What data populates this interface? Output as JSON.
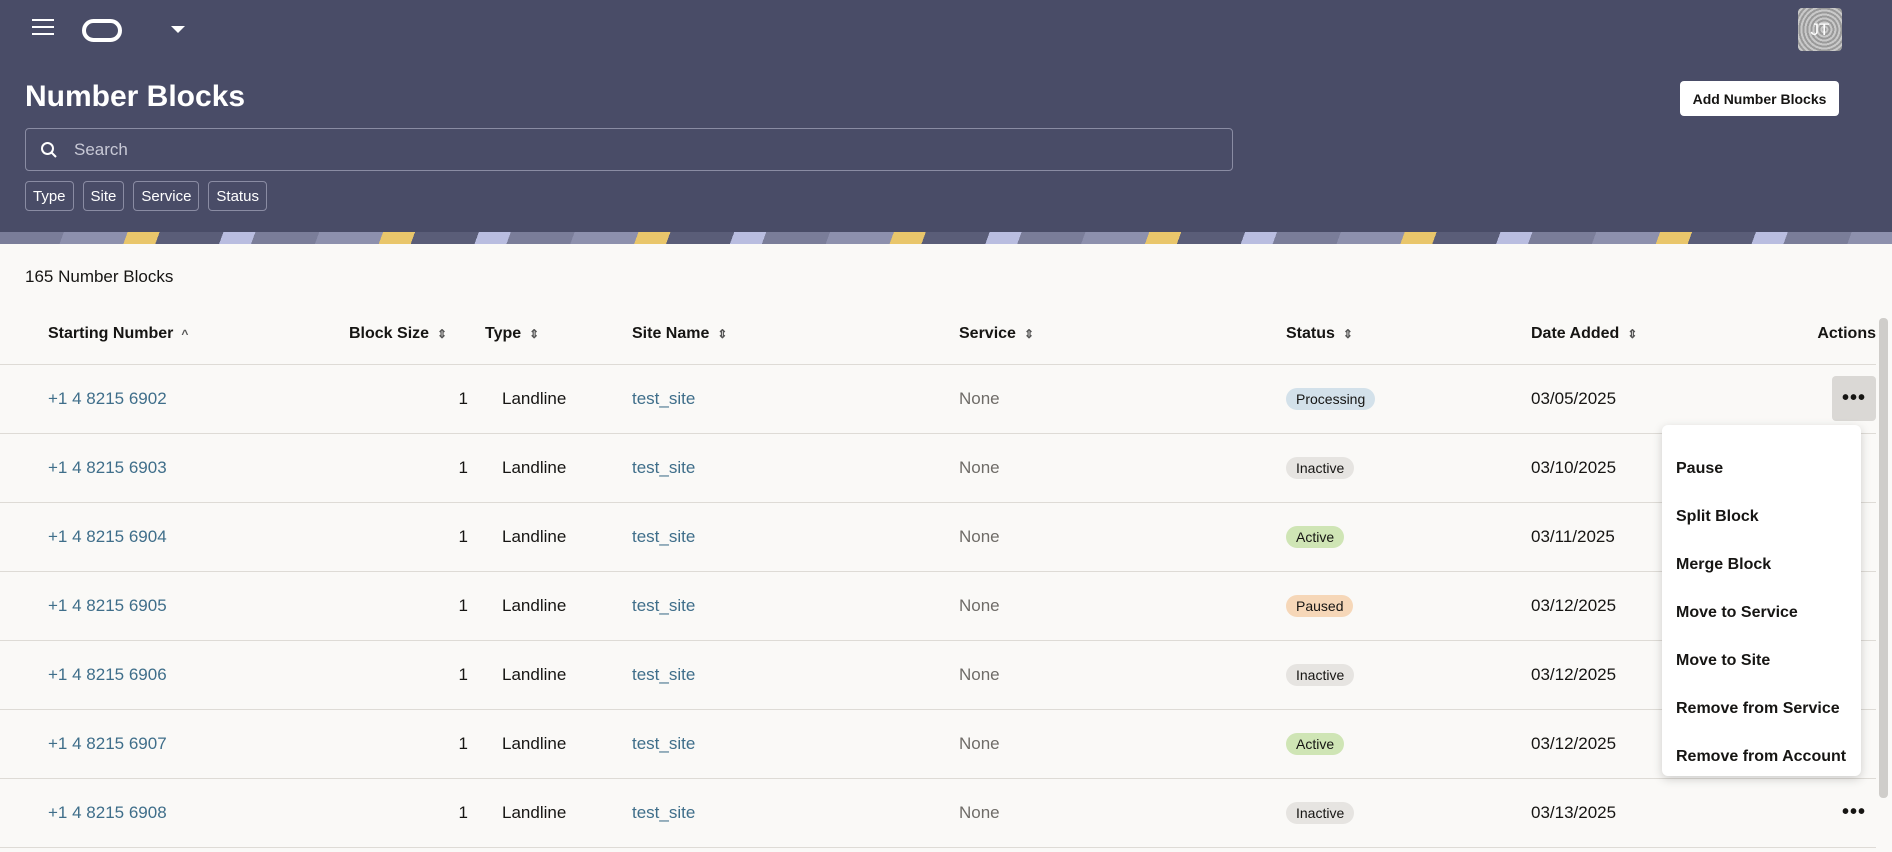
{
  "header": {
    "page_title": "Number Blocks",
    "add_button": "Add Number Blocks",
    "avatar_initials": "JT",
    "search_placeholder": "Search",
    "filters": [
      "Type",
      "Site",
      "Service",
      "Status"
    ]
  },
  "count_label": "165 Number Blocks",
  "table": {
    "columns": [
      "Starting Number",
      "Block Size",
      "Type",
      "Site Name",
      "Service",
      "Status",
      "Date Added",
      "Actions"
    ],
    "rows": [
      {
        "number": "+1 4 8215 6902",
        "size": "1",
        "type": "Landline",
        "site": "test_site",
        "service": "None",
        "status": "Processing",
        "date": "03/05/2025"
      },
      {
        "number": "+1 4 8215 6903",
        "size": "1",
        "type": "Landline",
        "site": "test_site",
        "service": "None",
        "status": "Inactive",
        "date": "03/10/2025"
      },
      {
        "number": "+1 4 8215 6904",
        "size": "1",
        "type": "Landline",
        "site": "test_site",
        "service": "None",
        "status": "Active",
        "date": "03/11/2025"
      },
      {
        "number": "+1 4 8215 6905",
        "size": "1",
        "type": "Landline",
        "site": "test_site",
        "service": "None",
        "status": "Paused",
        "date": "03/12/2025"
      },
      {
        "number": "+1 4 8215 6906",
        "size": "1",
        "type": "Landline",
        "site": "test_site",
        "service": "None",
        "status": "Inactive",
        "date": "03/12/2025"
      },
      {
        "number": "+1 4 8215 6907",
        "size": "1",
        "type": "Landline",
        "site": "test_site",
        "service": "None",
        "status": "Active",
        "date": "03/12/2025"
      },
      {
        "number": "+1 4 8215 6908",
        "size": "1",
        "type": "Landline",
        "site": "test_site",
        "service": "None",
        "status": "Inactive",
        "date": "03/13/2025"
      }
    ]
  },
  "actions_menu": [
    "Pause",
    "Split Block",
    "Merge Block",
    "Move to Service",
    "Move to Site",
    "Remove from Service",
    "Remove from Account"
  ],
  "colors": {
    "header_bg": "#494c67",
    "link": "#3f6e8a"
  }
}
